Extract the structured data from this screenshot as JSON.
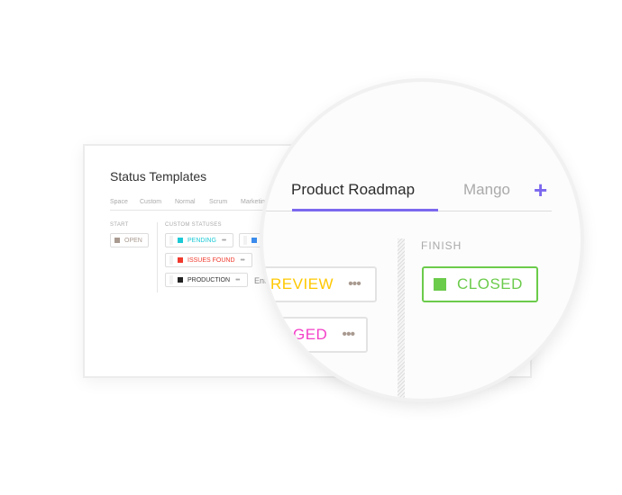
{
  "background_window": {
    "title": "Status Templates",
    "tabs": [
      "Space",
      "Custom",
      "Normal",
      "Scrum",
      "Marketing"
    ],
    "start_label": "START",
    "open_status": {
      "label": "OPEN",
      "color": "#a99a90"
    },
    "custom_label": "CUSTOM STATUSES",
    "custom_statuses": [
      {
        "label": "PENDING",
        "color": "#1ccad6"
      },
      {
        "label": "",
        "color": "#3b8ef0"
      },
      {
        "label": "ISSUES FOUND",
        "color": "#f03a2e"
      },
      {
        "label": "PRODUCTION",
        "color": "#222222"
      }
    ],
    "more": "•••",
    "enter_text": "Ent"
  },
  "magnifier": {
    "tabs": [
      {
        "label": "Product Roadmap",
        "active": true
      },
      {
        "label": "Mango",
        "active": false
      }
    ],
    "add_icon": "+",
    "accent": "#7b68ee",
    "review": {
      "label": "REVIEW",
      "color": "#ffc800"
    },
    "merged": {
      "label": "GED",
      "color": "#f33fc8"
    },
    "finish_label": "FINISH",
    "closed": {
      "label": "CLOSED",
      "color": "#6bcb4b"
    },
    "more": "•••"
  }
}
